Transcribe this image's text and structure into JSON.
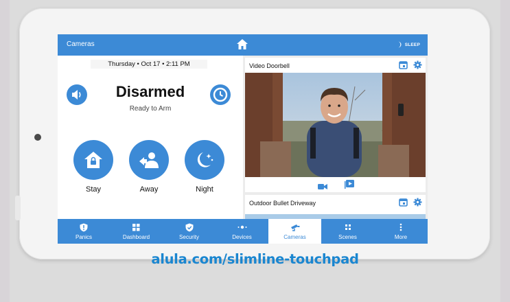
{
  "topbar": {
    "title": "Cameras",
    "sleep_label": "SLEEP"
  },
  "datetime": "Thursday • Oct 17 • 2:11 PM",
  "security": {
    "status": "Disarmed",
    "substatus": "Ready to Arm"
  },
  "arm_buttons": [
    {
      "label": "Stay",
      "icon": "home-lock-icon"
    },
    {
      "label": "Away",
      "icon": "person-leave-icon"
    },
    {
      "label": "Night",
      "icon": "moon-stars-icon"
    }
  ],
  "cameras": [
    {
      "name": "Video Doorbell"
    },
    {
      "name": "Outdoor Bullet Driveway"
    }
  ],
  "nav": [
    {
      "label": "Panics",
      "icon": "shield-alert-icon"
    },
    {
      "label": "Dashboard",
      "icon": "grid-icon"
    },
    {
      "label": "Security",
      "icon": "shield-check-icon"
    },
    {
      "label": "Devices",
      "icon": "devices-icon"
    },
    {
      "label": "Cameras",
      "icon": "camera-icon",
      "active": true
    },
    {
      "label": "Scenes",
      "icon": "scenes-icon"
    },
    {
      "label": "More",
      "icon": "more-icon"
    }
  ],
  "footer_url": "alula.com/slimline-touchpad",
  "colors": {
    "accent": "#3c8ad6",
    "url": "#1a86d0"
  }
}
